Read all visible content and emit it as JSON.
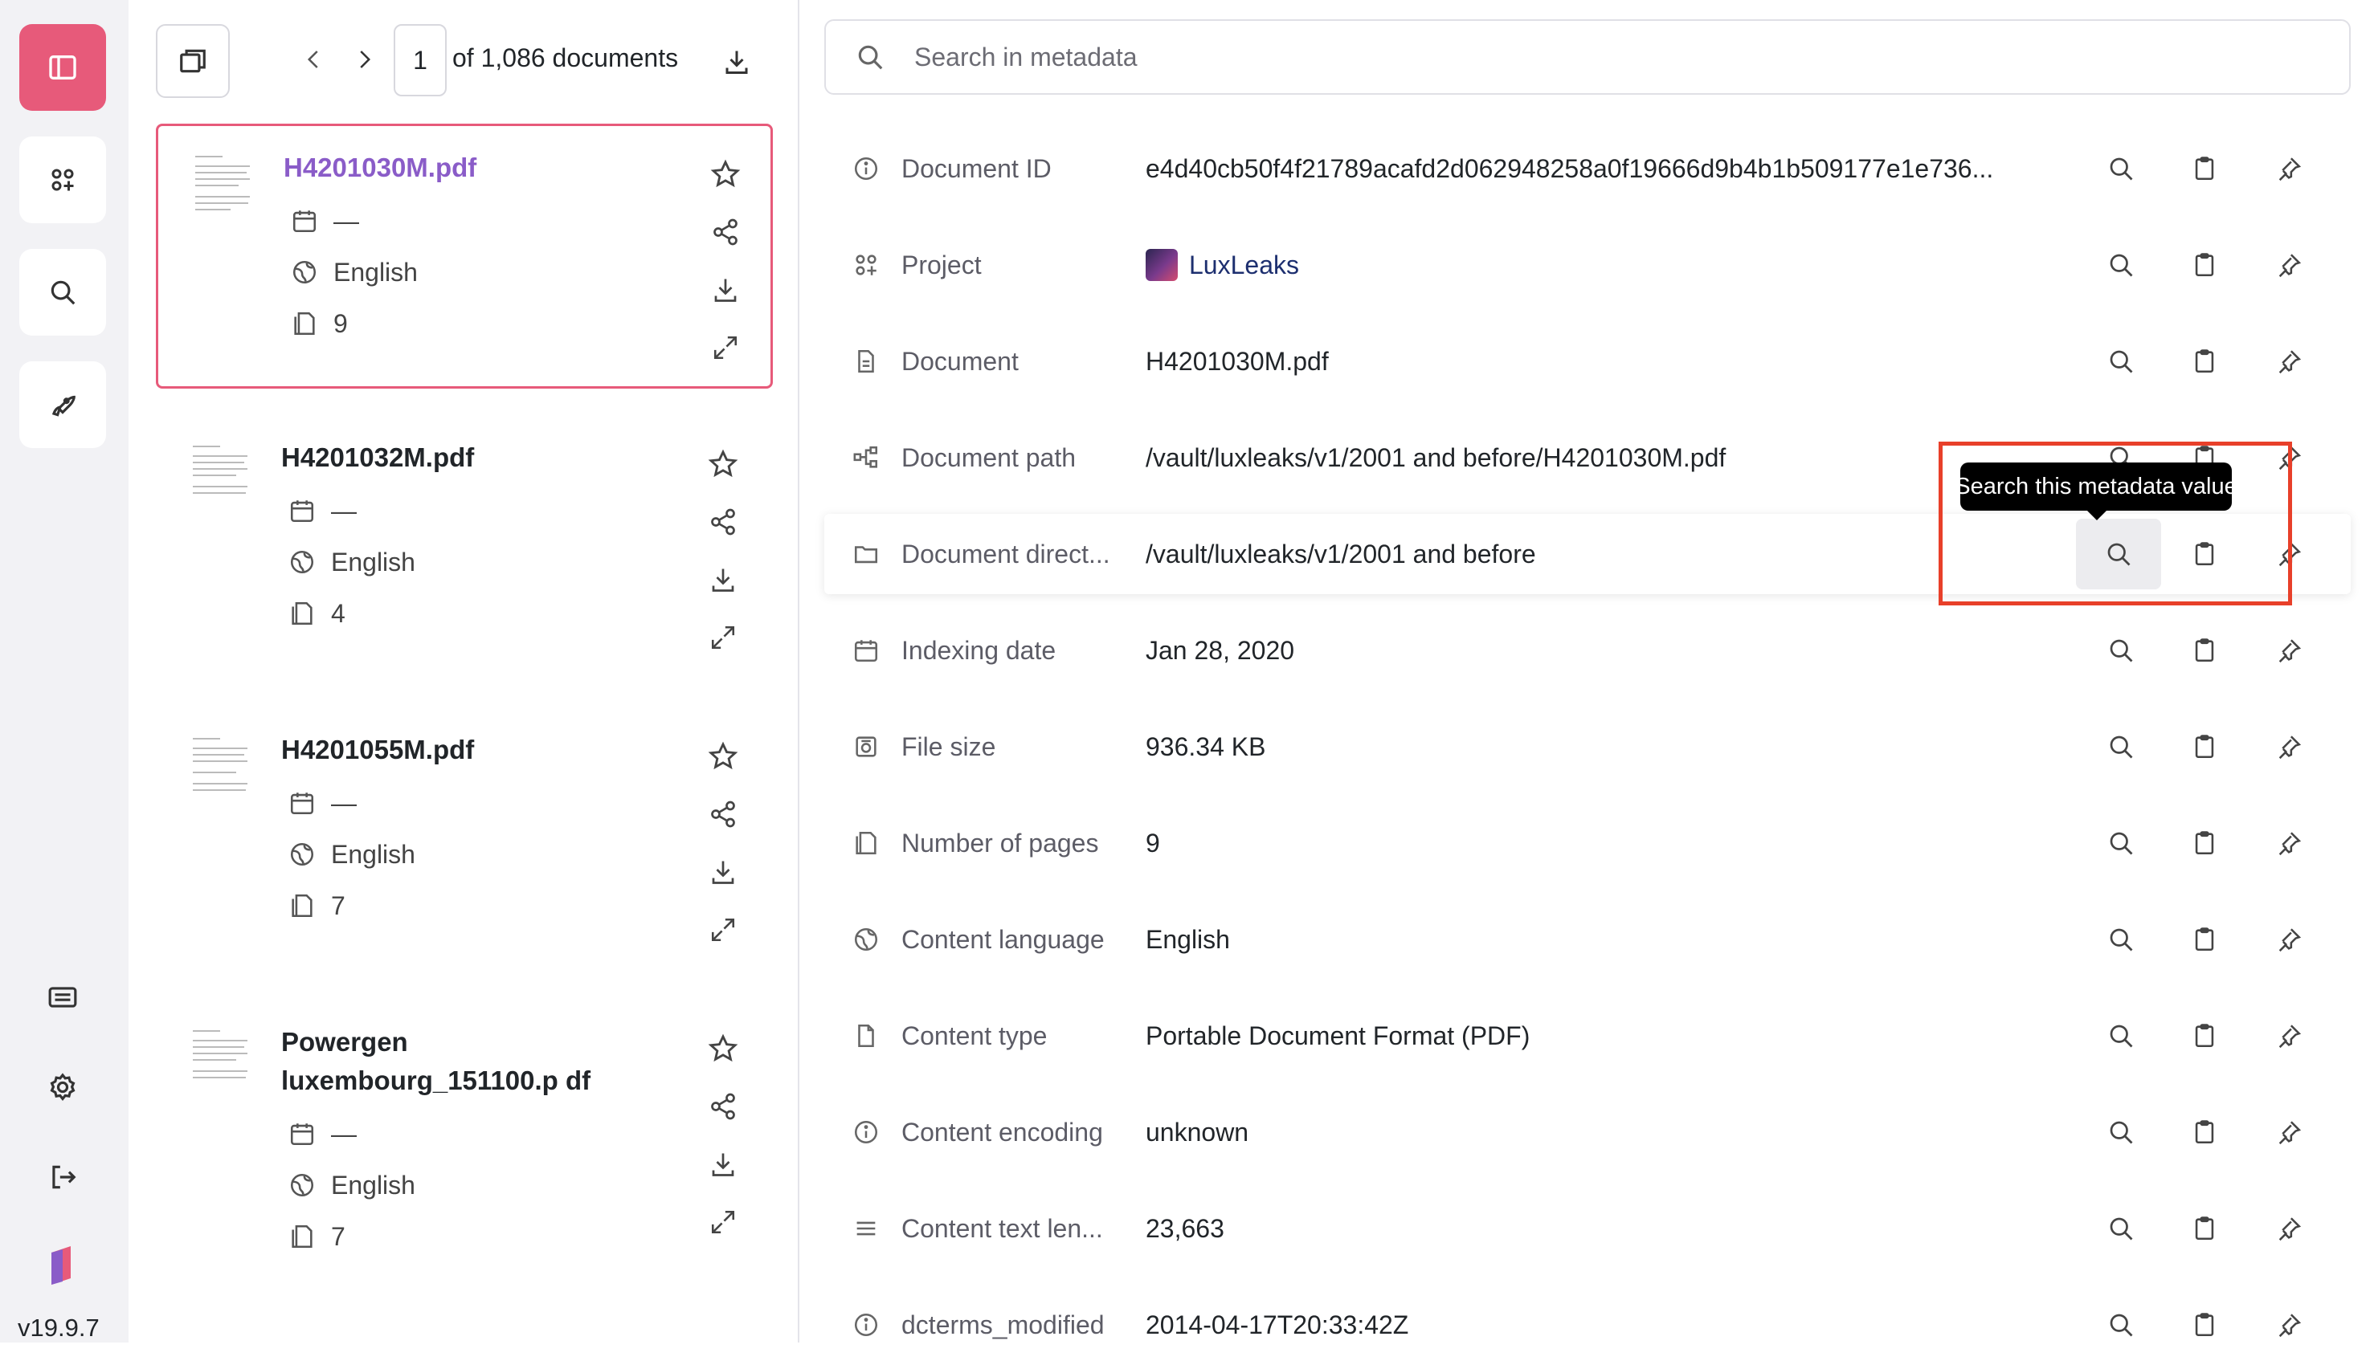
{
  "app": {
    "version": "v19.9.7",
    "accent": "#e75a7a"
  },
  "nav": {
    "items": [
      {
        "name": "toggle-sidebar",
        "icon": "sidebar-icon"
      },
      {
        "name": "projects",
        "icon": "grid-plus-icon"
      },
      {
        "name": "search",
        "icon": "search-icon"
      },
      {
        "name": "tasks",
        "icon": "rocket-icon"
      }
    ],
    "bottom": [
      {
        "name": "keyboard",
        "icon": "keyboard-icon"
      },
      {
        "name": "settings",
        "icon": "gear-icon"
      },
      {
        "name": "logout",
        "icon": "logout-icon"
      },
      {
        "name": "logo",
        "icon": "datashare-logo"
      }
    ]
  },
  "list": {
    "page": "1",
    "of_text": "of 1,086 documents",
    "documents": [
      {
        "title": "H4201030M.pdf",
        "date": "—",
        "language": "English",
        "pages": "9"
      },
      {
        "title": "H4201032M.pdf",
        "date": "—",
        "language": "English",
        "pages": "4"
      },
      {
        "title": "H4201055M.pdf",
        "date": "—",
        "language": "English",
        "pages": "7"
      },
      {
        "title": "Powergen luxembourg_151100.p df",
        "date": "—",
        "language": "English",
        "pages": "7"
      }
    ]
  },
  "metadata": {
    "search_placeholder": "Search in metadata",
    "tooltip": "Search this metadata value",
    "rows": [
      {
        "label": "Document ID",
        "value": "e4d40cb50f4f21789acafd2d062948258a0f19666d9b4b1b509177e1e736...",
        "icon": "info-icon"
      },
      {
        "label": "Project",
        "value": "LuxLeaks",
        "icon": "grid-plus-icon"
      },
      {
        "label": "Document",
        "value": "H4201030M.pdf",
        "icon": "file-icon"
      },
      {
        "label": "Document path",
        "value": "/vault/luxleaks/v1/2001 and before/H4201030M.pdf",
        "icon": "tree-icon"
      },
      {
        "label": "Document direct...",
        "value": "/vault/luxleaks/v1/2001 and before",
        "icon": "folder-icon"
      },
      {
        "label": "Indexing date",
        "value": "Jan 28, 2020",
        "icon": "calendar-icon"
      },
      {
        "label": "File size",
        "value": "936.34 KB",
        "icon": "hard-drive-icon"
      },
      {
        "label": "Number of pages",
        "value": "9",
        "icon": "pages-icon"
      },
      {
        "label": "Content language",
        "value": "English",
        "icon": "globe-icon"
      },
      {
        "label": "Content type",
        "value": "Portable Document Format (PDF)",
        "icon": "file-blank-icon"
      },
      {
        "label": "Content encoding",
        "value": "unknown",
        "icon": "info-icon"
      },
      {
        "label": "Content text len...",
        "value": "23,663",
        "icon": "text-lines-icon"
      },
      {
        "label": "dcterms_modified",
        "value": "2014-04-17T20:33:42Z",
        "icon": "info-icon"
      }
    ]
  }
}
